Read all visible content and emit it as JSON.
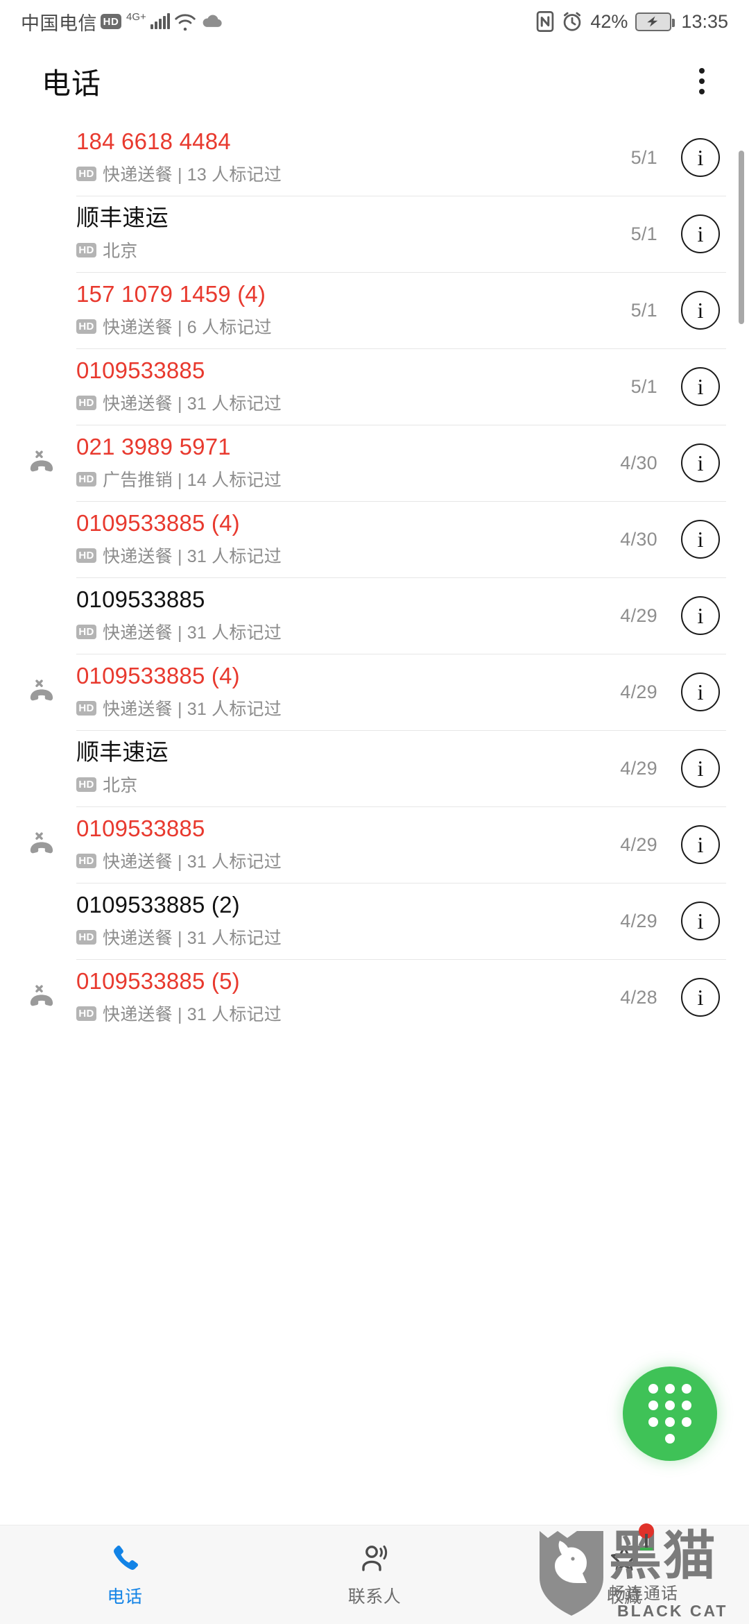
{
  "status_bar": {
    "carrier": "中国电信",
    "hd_label": "HD",
    "network": "4G+",
    "signal_icon": "signal-bars-icon",
    "wifi_icon": "wifi-icon",
    "cloud_icon": "cloud-icon",
    "nfc_icon": "nfc-icon",
    "alarm_icon": "alarm-clock-icon",
    "battery_percent": "42%",
    "battery_icon": "battery-charging-icon",
    "time": "13:35"
  },
  "app_bar": {
    "title": "电话",
    "overflow_icon": "overflow-menu-icon"
  },
  "colors": {
    "spam_red": "#e8392e",
    "fab_green": "#3fc257",
    "active_blue": "#1283e6",
    "hd_badge_gray": "#b4b4b4"
  },
  "call_log": {
    "rows": [
      {
        "name": "184 6618 4484",
        "spam": true,
        "missed": false,
        "hd": "HD",
        "subtitle": "快递送餐 | 13 人标记过",
        "date": "5/1",
        "info_icon": "info-icon"
      },
      {
        "name": "顺丰速运",
        "spam": false,
        "missed": false,
        "hd": "HD",
        "subtitle": "北京",
        "date": "5/1",
        "info_icon": "info-icon"
      },
      {
        "name": "157 1079 1459 (4)",
        "spam": true,
        "missed": false,
        "hd": "HD",
        "subtitle": "快递送餐 | 6 人标记过",
        "date": "5/1",
        "info_icon": "info-icon"
      },
      {
        "name": "0109533885",
        "spam": true,
        "missed": false,
        "hd": "HD",
        "subtitle": "快递送餐 | 31 人标记过",
        "date": "5/1",
        "info_icon": "info-icon"
      },
      {
        "name": "021 3989 5971",
        "spam": true,
        "missed": true,
        "hd": "HD",
        "subtitle": "广告推销 | 14 人标记过",
        "date": "4/30",
        "info_icon": "info-icon"
      },
      {
        "name": "0109533885 (4)",
        "spam": true,
        "missed": false,
        "hd": "HD",
        "subtitle": "快递送餐 | 31 人标记过",
        "date": "4/30",
        "info_icon": "info-icon"
      },
      {
        "name": "0109533885",
        "spam": false,
        "missed": false,
        "hd": "HD",
        "subtitle": "快递送餐 | 31 人标记过",
        "date": "4/29",
        "info_icon": "info-icon"
      },
      {
        "name": "0109533885 (4)",
        "spam": true,
        "missed": true,
        "hd": "HD",
        "subtitle": "快递送餐 | 31 人标记过",
        "date": "4/29",
        "info_icon": "info-icon"
      },
      {
        "name": "顺丰速运",
        "spam": false,
        "missed": false,
        "hd": "HD",
        "subtitle": "北京",
        "date": "4/29",
        "info_icon": "info-icon"
      },
      {
        "name": "0109533885",
        "spam": true,
        "missed": true,
        "hd": "HD",
        "subtitle": "快递送餐 | 31 人标记过",
        "date": "4/29",
        "info_icon": "info-icon"
      },
      {
        "name": "0109533885 (2)",
        "spam": false,
        "missed": false,
        "hd": "HD",
        "subtitle": "快递送餐 | 31 人标记过",
        "date": "4/29",
        "info_icon": "info-icon"
      },
      {
        "name": "0109533885 (5)",
        "spam": true,
        "missed": true,
        "hd": "HD",
        "subtitle": "快递送餐 | 31 人标记过",
        "date": "4/28",
        "info_icon": "info-icon"
      }
    ]
  },
  "fab": {
    "icon": "dialpad-icon"
  },
  "bottom_nav": {
    "items": [
      {
        "label": "电话",
        "icon": "phone-handset-icon",
        "active": true
      },
      {
        "label": "联系人",
        "icon": "contacts-person-icon",
        "active": false
      },
      {
        "label": "收藏",
        "icon": "star-outline-icon",
        "active": false
      }
    ]
  },
  "watermark": {
    "logo_icon": "black-cat-shield-logo",
    "brand_cn": "黑猫",
    "sub_cn": "畅连通话",
    "brand_en": "BLACK CAT"
  }
}
